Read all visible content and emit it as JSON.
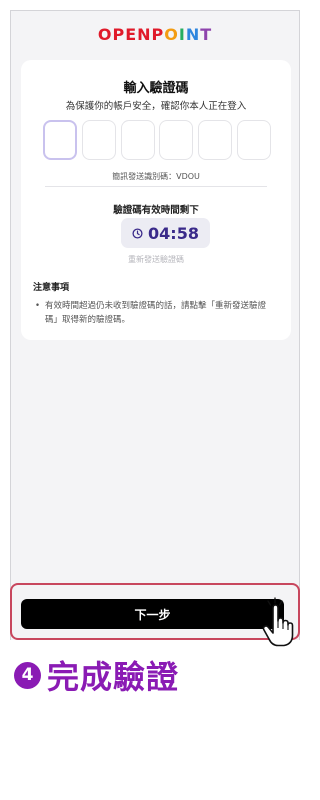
{
  "app": {
    "logo_text": "OPENPOINT",
    "logo_colors": [
      "#e01a2a",
      "#e01a2a",
      "#e01a2a",
      "#e01a2a",
      "#e01a2a",
      "#f39c12",
      "#27ae60",
      "#2e86de",
      "#8e44ad"
    ]
  },
  "card": {
    "title": "輸入驗證碼",
    "subtitle": "為保護你的帳戶安全，確認你本人正在登入",
    "code_length": 6,
    "sent_id": "簡訊發送識別碼：VDOU",
    "timer_label": "驗證碼有效時間剩下",
    "timer_value": "04:58",
    "resend_label": "重新發送驗證碼"
  },
  "notice": {
    "title": "注意事項",
    "bullet": "•",
    "text": "有效時間超過仍未收到驗證碼的話，請點擊「重新發送驗證碼」取得新的驗證碼。"
  },
  "footer": {
    "next_label": "下一步"
  },
  "step": {
    "number": "4",
    "label": "完成驗證",
    "color": "#8a1bb4"
  },
  "colors": {
    "accent": "#3a2a8a",
    "highlight_frame": "#c8475e"
  }
}
